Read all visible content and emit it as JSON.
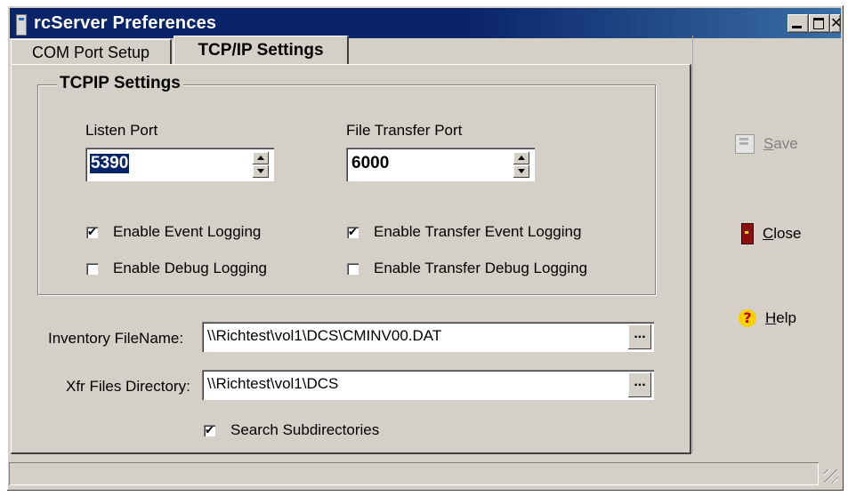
{
  "window": {
    "title": "rcServer Preferences",
    "controls": [
      "_",
      "□",
      "✕"
    ]
  },
  "tabs": [
    {
      "label": "COM Port Setup",
      "active": false
    },
    {
      "label": "TCP/IP Settings",
      "active": true
    }
  ],
  "tcpip_group": {
    "legend": "TCPIP Settings",
    "listen_port": {
      "label": "Listen Port",
      "value": "5390"
    },
    "file_transfer_port": {
      "label": "File Transfer Port",
      "value": "6000"
    },
    "checkboxes": {
      "event_logging": {
        "label": "Enable Event Logging",
        "checked": true
      },
      "debug_logging": {
        "label": "Enable Debug Logging",
        "checked": false
      },
      "transfer_event_logging": {
        "label": "Enable Transfer Event Logging",
        "checked": true
      },
      "transfer_debug_logging": {
        "label": "Enable Transfer Debug Logging",
        "checked": false
      }
    }
  },
  "inventory": {
    "label": "Inventory FileName:",
    "value": "\\\\Richtest\\vol1\\DCS\\CMINV00.DAT",
    "browse_label": "..."
  },
  "xfr_dir": {
    "label": "Xfr Files Directory:",
    "value": "\\\\Richtest\\vol1\\DCS",
    "browse_label": "..."
  },
  "search_subdirs": {
    "label": "Search Subdirectories",
    "checked": true
  },
  "side_buttons": {
    "save": {
      "accel": "S",
      "rest": "ave",
      "enabled": false
    },
    "close": {
      "accel": "C",
      "rest": "lose",
      "enabled": true
    },
    "help": {
      "accel": "H",
      "rest": "elp",
      "enabled": true
    }
  },
  "check_mark": "✔",
  "colors": {
    "titlebar": "#0a246a",
    "face": "#d4d0c8",
    "selection": "#0a246a"
  }
}
